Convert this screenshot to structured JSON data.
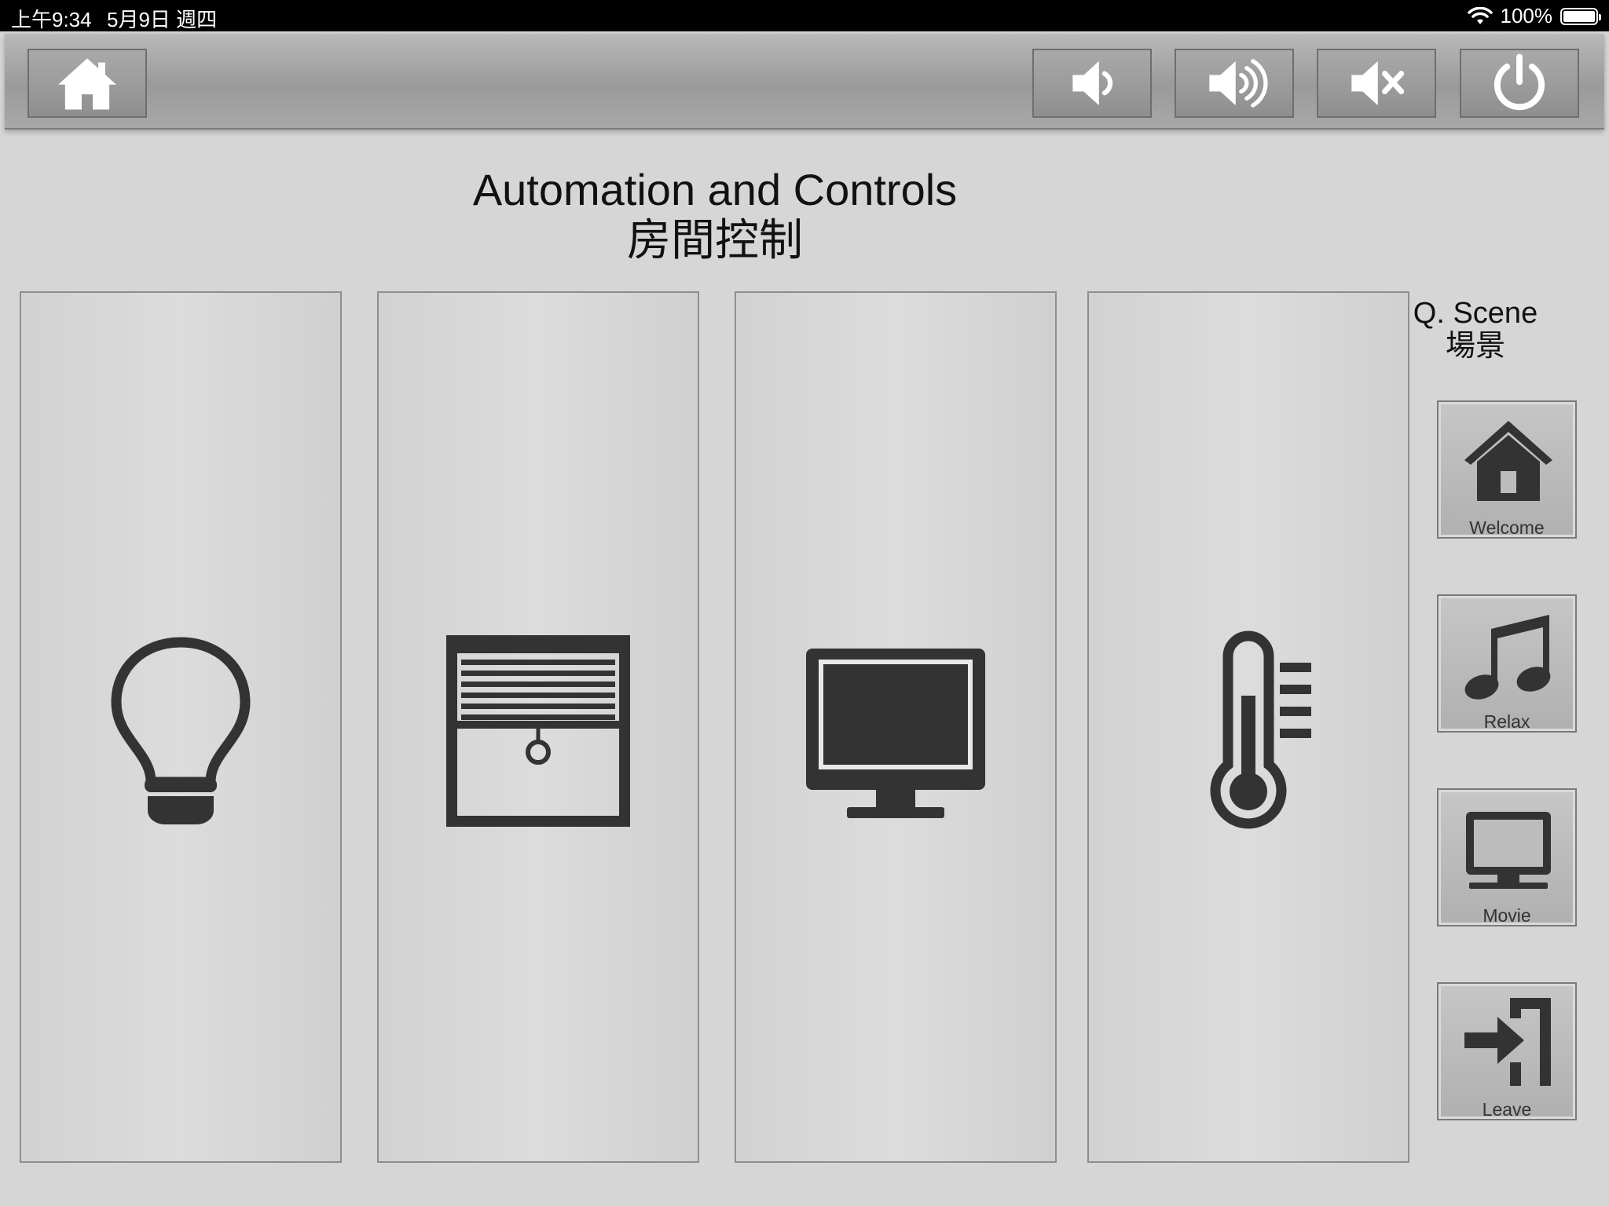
{
  "status_bar": {
    "time": "上午9:34",
    "date": "5月9日 週四",
    "battery_percent": "100%",
    "battery_level": 1.0
  },
  "toolbar": {
    "home_icon": "home-icon",
    "volume_down_icon": "volume-down-icon",
    "volume_up_icon": "volume-up-icon",
    "mute_icon": "mute-icon",
    "power_icon": "power-icon"
  },
  "header": {
    "title_en": "Automation and Controls",
    "title_zh": "房間控制"
  },
  "panels": [
    {
      "icon": "light-bulb-icon"
    },
    {
      "icon": "window-blind-icon"
    },
    {
      "icon": "monitor-icon"
    },
    {
      "icon": "thermometer-icon"
    }
  ],
  "quick_scene": {
    "title_en": "Q. Scene",
    "title_zh": "場景",
    "items": [
      {
        "label": "Welcome",
        "icon": "home-icon"
      },
      {
        "label": "Relax",
        "icon": "music-note-icon"
      },
      {
        "label": "Movie",
        "icon": "tv-icon"
      },
      {
        "label": "Leave",
        "icon": "exit-icon"
      }
    ]
  },
  "colors": {
    "background": "#d6d6d6",
    "toolbar": "#9e9e9e",
    "icon_light": "#ffffff",
    "icon_dark": "#333333"
  }
}
